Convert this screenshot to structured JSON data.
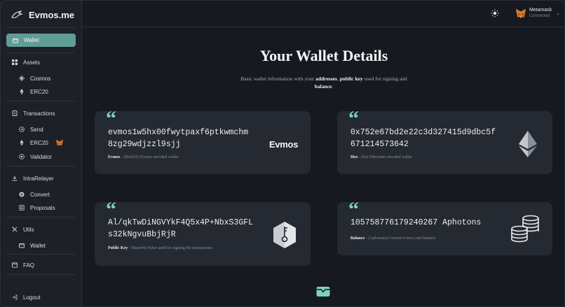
{
  "brand": {
    "name": "Evmos.me",
    "logo_icon": "evmos-bird-icon"
  },
  "sidebar": {
    "wallet": {
      "label": "Wallet",
      "icon": "wallet-icon"
    },
    "assets": {
      "label": "Assets",
      "icon": "grid-icon"
    },
    "cosmos": {
      "label": "Cosmos",
      "icon": "cosmos-icon"
    },
    "erc20": {
      "label": "ERC20",
      "icon": "ethereum-icon"
    },
    "transactions": {
      "label": "Transactions",
      "icon": "document-icon"
    },
    "send": {
      "label": "Send",
      "icon": "send-icon"
    },
    "erc20_tx": {
      "label": "ERC20",
      "icon": "ethereum-icon"
    },
    "validator": {
      "label": "Validator",
      "icon": "validator-icon"
    },
    "intrarelayer": {
      "label": "IntraRelayer",
      "icon": "relayer-icon"
    },
    "convert": {
      "label": "Convert",
      "icon": "convert-icon"
    },
    "proposals": {
      "label": "Proposals",
      "icon": "proposals-icon"
    },
    "utils": {
      "label": "Utils",
      "icon": "tools-icon"
    },
    "utils_wallet": {
      "label": "Wallet",
      "icon": "wallet-icon"
    },
    "faq": {
      "label": "FAQ",
      "icon": "faq-icon"
    },
    "logout": {
      "label": "Logout",
      "icon": "logout-icon"
    }
  },
  "topbar": {
    "theme_icon": "sun-icon",
    "account": {
      "name": "Metamask",
      "status": "Connected"
    }
  },
  "main": {
    "title": "Your Wallet Details",
    "subtitle_parts": {
      "a": "Basic wallet information with your ",
      "b": "addresses",
      "c": ", ",
      "d": "public key",
      "e": " used for signing and ",
      "f": "balance",
      "g": "."
    }
  },
  "cards": {
    "bech32": {
      "line1": "evmos1w5hx00fwytpaxf6ptkwmchm",
      "line2": "8zg29wdjzzl9sjj",
      "caption_label": "Evmos",
      "caption_text": " - (Bech32) Evmos encoded wallet",
      "logo_text": "Evmos"
    },
    "hex": {
      "line1": "0x752e67bd2e22c3d327415d9dbc5f",
      "line2": "671214573642",
      "caption_label": "Hex",
      "caption_text": " - (0x) Ethereum encoded wallet",
      "logo": "ethereum-logo-icon"
    },
    "pubkey": {
      "line1": "Al/qkTwDiNGVYkF4Q5x4P+NbxS3GFL",
      "line2": "s32kNgvuBbjRjR",
      "caption_label": "Public Key",
      "caption_text": " - (Base64) Value used for signing the transactions",
      "logo": "key-hexagon-icon"
    },
    "balance": {
      "line1": "105758776179240267 Aphotons",
      "caption_label": "Balance",
      "caption_text": " - (Aphotons) Current evmos coin balance",
      "logo": "coins-stack-icon"
    }
  },
  "colors": {
    "accent": "#5f9d96",
    "quote": "#7fd0c3",
    "background": "#161a20",
    "card": "#252a32"
  }
}
